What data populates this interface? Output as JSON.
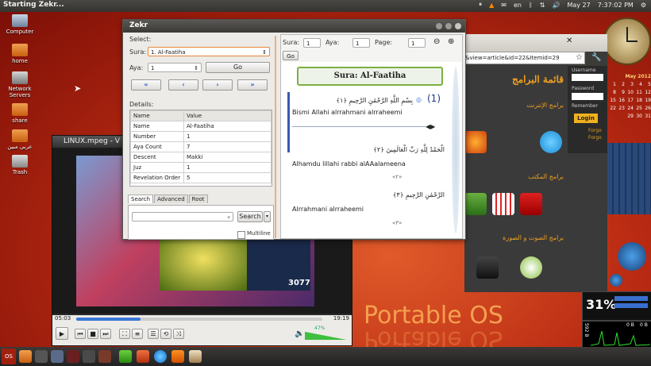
{
  "top_panel": {
    "title": "Starting Zekr...",
    "tray_lang": "en",
    "tray_date": "May 27",
    "tray_time": "7:37:02 PM"
  },
  "desktop_icons": [
    "Computer",
    "home",
    "Network Servers",
    "share",
    "عربي مبين",
    "Trash"
  ],
  "zekr": {
    "title": "Zekr",
    "select_label": "Select:",
    "sura_label": "Sura:",
    "sura_value": "1. Al-Faatiha",
    "aya_label": "Aya:",
    "aya_value": "1",
    "go_label": "Go",
    "nav": [
      "«",
      "‹",
      "›",
      "»"
    ],
    "details_label": "Details:",
    "details_headers": [
      "Name",
      "Value"
    ],
    "details_rows": [
      [
        "Name",
        "Al-Faatiha"
      ],
      [
        "Number",
        "1"
      ],
      [
        "Aya Count",
        "7"
      ],
      [
        "Descent",
        "Makki"
      ],
      [
        "Juz",
        "1"
      ],
      [
        "Revelation Order",
        "5"
      ]
    ],
    "tabs": [
      "Search",
      "Advanced",
      "Root"
    ],
    "search_button": "Search",
    "multiline_label": "Multiline",
    "view": {
      "sura_label": "Sura:",
      "sura_value": "1",
      "aya_label": "Aya:",
      "aya_value": "1",
      "page_label": "Page:",
      "page_value": "1",
      "go_label": "Go",
      "banner": "Sura: Al-Faatiha",
      "aya_number": "(1)",
      "verses": [
        {
          "ar": "بِسْمِ اللَّهِ الرَّحْمَٰنِ الرَّحِيمِ",
          "num": "﴿١﴾",
          "tr": "Bismi Allahi alrrahmani alrraheemi"
        },
        {
          "ar": "الْحَمْدُ لِلَّهِ رَبِّ الْعَالَمِينَ",
          "num": "﴿٢﴾",
          "tr": "Alhamdu lillahi rabbi alAAalameena"
        },
        {
          "ar": "الرَّحْمَٰنِ الرَّحِيمِ",
          "num": "﴿٣﴾",
          "tr": "Alrrahmani alrraheemi"
        }
      ]
    }
  },
  "browser": {
    "url": "&view=article&id=22&Itemid=29",
    "heading": "قائمة البرامج",
    "section_internet": "برامج الإنترنت",
    "section_office": "برامج المكتب",
    "section_media": "برامج الصوت و الصورة",
    "username_label": "Username",
    "password_label": "Password",
    "remember_label": "Remember",
    "login_button": "Login",
    "forgot1": "Forgo",
    "forgot2": "Forgo"
  },
  "calendar": {
    "title": "May 2012",
    "rows": [
      [
        "1",
        "2",
        "3",
        "4",
        "5"
      ],
      [
        "8",
        "9",
        "10",
        "11",
        "12"
      ],
      [
        "15",
        "16",
        "17",
        "18",
        "19"
      ],
      [
        "22",
        "23",
        "24",
        "25",
        "26"
      ],
      [
        "29",
        "30",
        "31"
      ]
    ]
  },
  "video": {
    "title": "LINUX.mpeg - V",
    "time_elapsed": "05:03",
    "time_total": "19:19",
    "progress_fraction": 0.26,
    "volume": "47%",
    "inner_numbers": "3077"
  },
  "portable_os": "Portable OS",
  "widgets": {
    "cpu_percent": "31%",
    "net_down": "0 B",
    "net_up": "0 B",
    "mem_label": "592 B"
  },
  "bottom_panel": {
    "os_label": "OS"
  }
}
